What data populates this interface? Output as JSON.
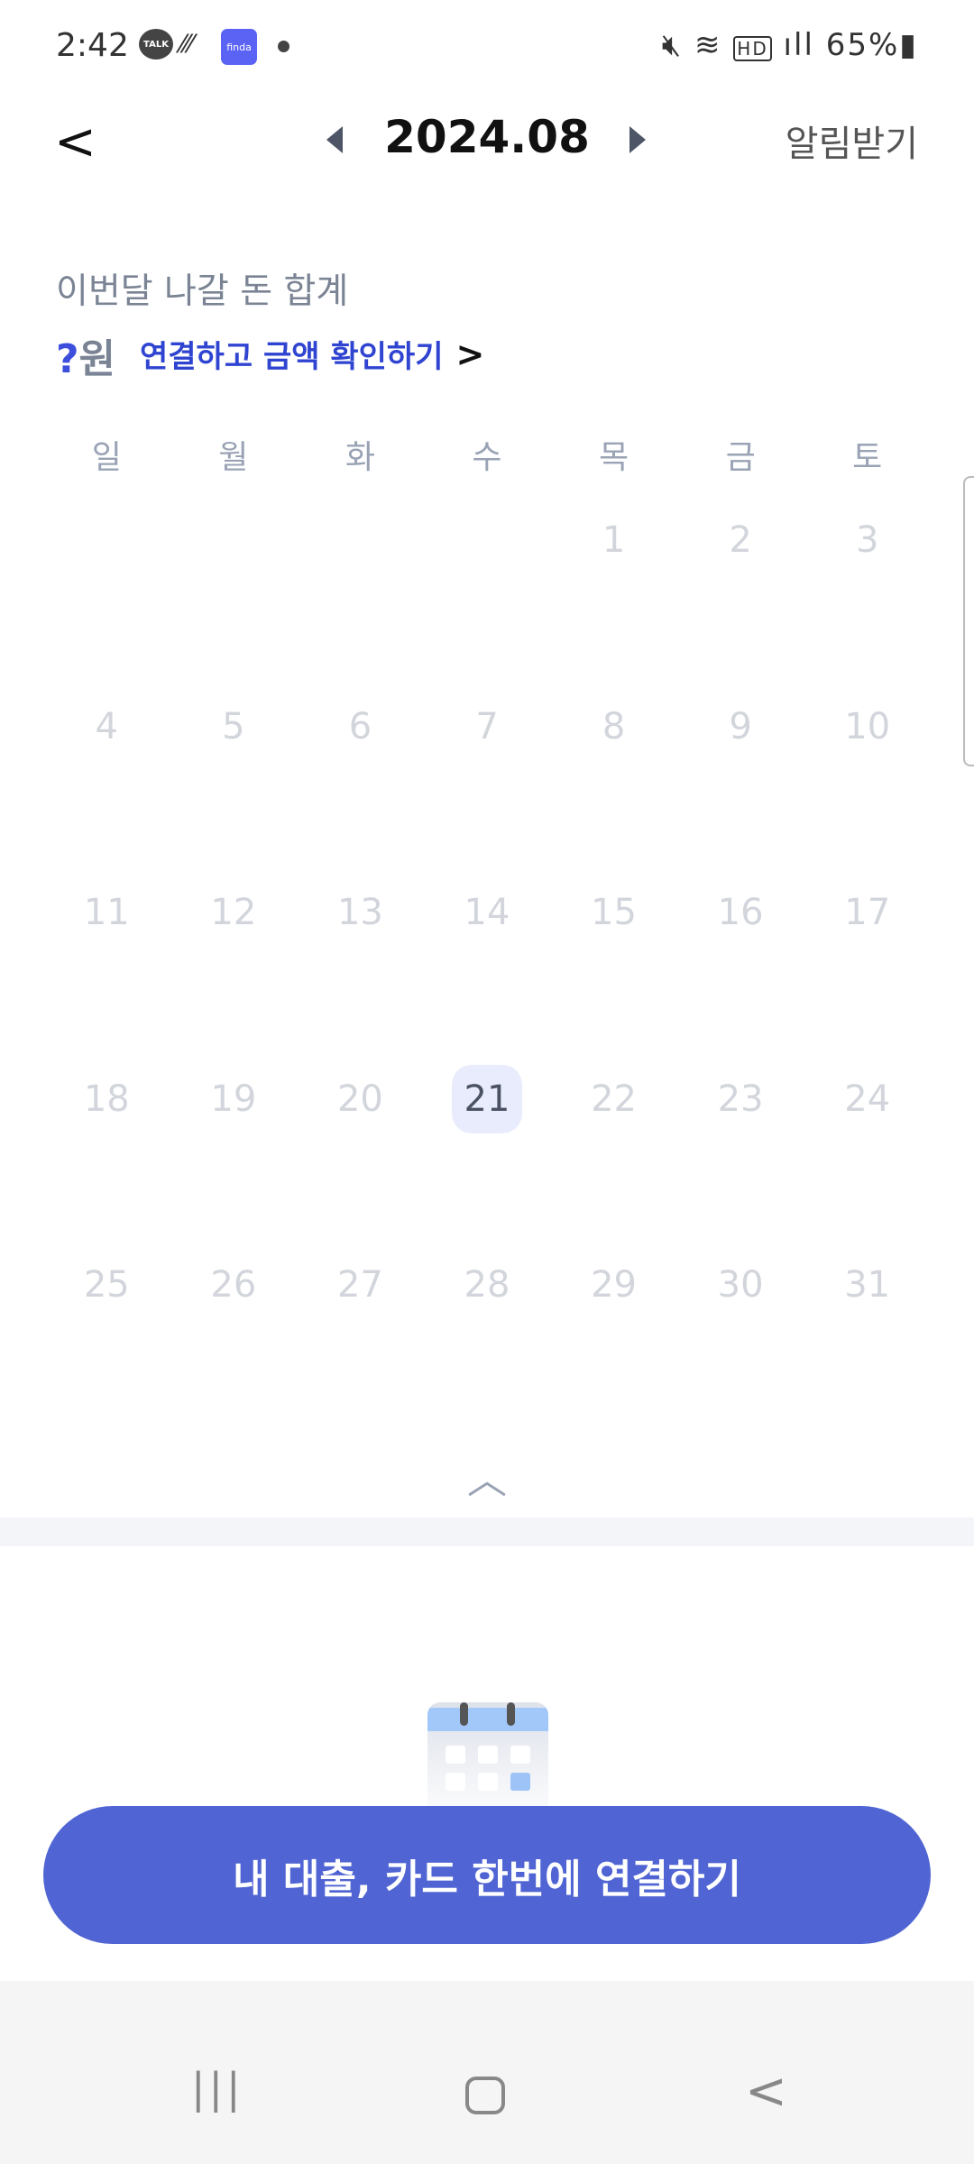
{
  "status_bar": {
    "time": "2:42",
    "talk": "TALK",
    "finda": "finda",
    "battery": "65%",
    "icons": [
      "kakaotalk-icon",
      "finda-app-icon",
      "mute-icon",
      "wifi-icon",
      "hd-icon",
      "signal-icon",
      "battery-charging-icon"
    ]
  },
  "header": {
    "title": "2024.08",
    "alarm": "알림받기"
  },
  "summary": {
    "label": "이번달 나갈 돈 합계",
    "amount": "?",
    "unit": "원",
    "link": "연결하고 금액 확인하기"
  },
  "weekdays": [
    "일",
    "월",
    "화",
    "수",
    "목",
    "금",
    "토"
  ],
  "days": [
    "",
    "",
    "",
    "",
    "1",
    "2",
    "3",
    "4",
    "5",
    "6",
    "7",
    "8",
    "9",
    "10",
    "11",
    "12",
    "13",
    "14",
    "15",
    "16",
    "17",
    "18",
    "19",
    "20",
    "21",
    "22",
    "23",
    "24",
    "25",
    "26",
    "27",
    "28",
    "29",
    "30",
    "31"
  ],
  "today": "21",
  "cta": "내 대출, 카드 한번에 연결하기",
  "colors": {
    "accent": "#5065d3",
    "link": "#2f44d0",
    "today_bg": "#e9ecfc"
  }
}
